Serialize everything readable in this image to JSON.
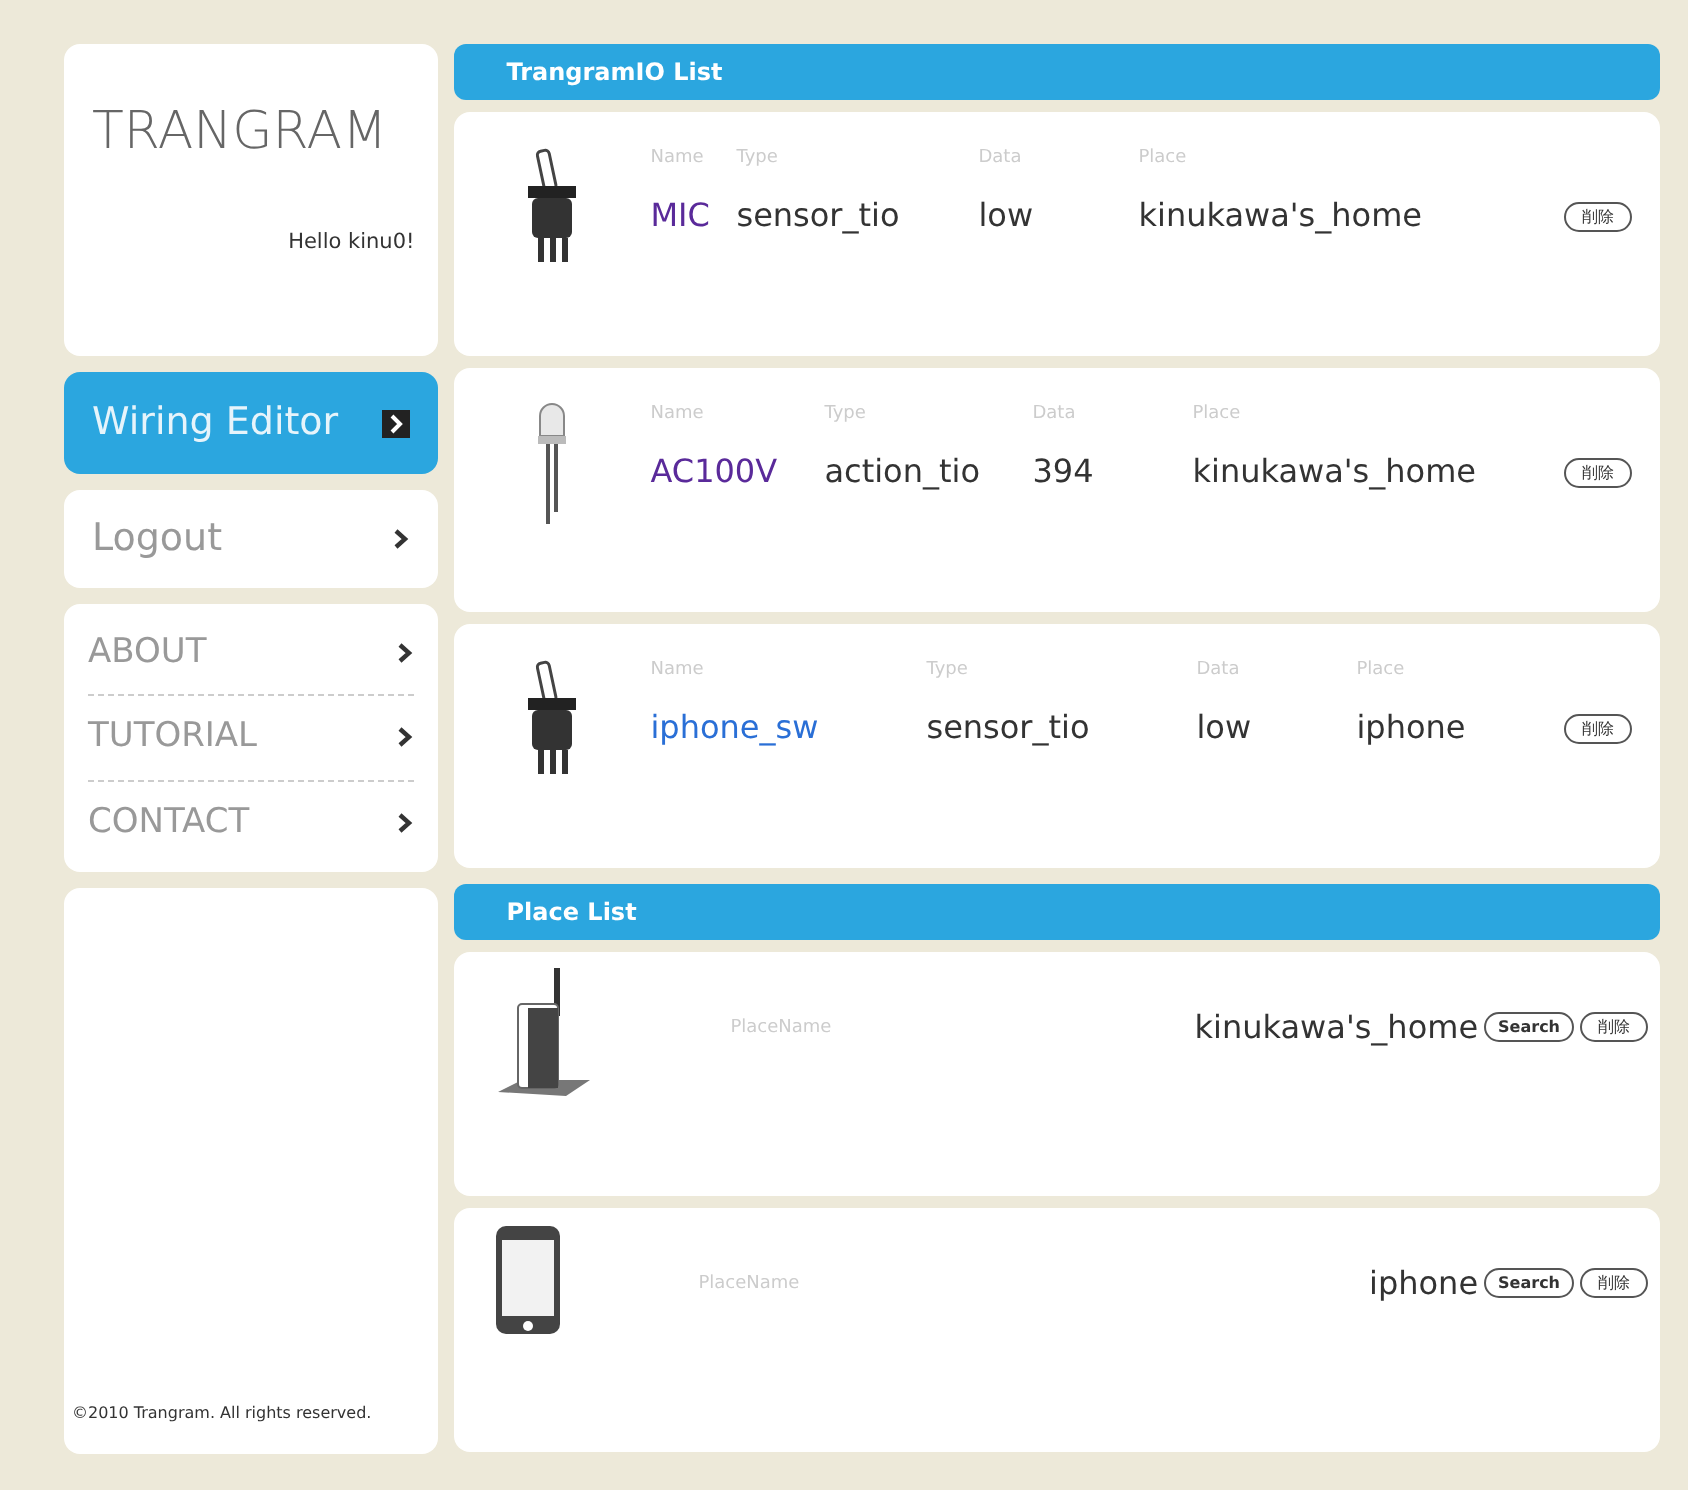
{
  "sidebar": {
    "logo": "TRANGRAM",
    "greeting": "Hello kinu0!",
    "nav_groups": [
      {
        "items": [
          {
            "label": "Wiring Editor",
            "selected": true
          }
        ]
      },
      {
        "items": [
          {
            "label": "Logout",
            "selected": false
          }
        ]
      },
      {
        "items": [
          {
            "label": "ABOUT",
            "selected": false
          },
          {
            "label": "TUTORIAL",
            "selected": false
          },
          {
            "label": "CONTACT",
            "selected": false
          }
        ]
      }
    ],
    "footer": "©2010 Trangram. All rights reserved."
  },
  "io_list": {
    "title": "TrangramIO List",
    "rows": [
      {
        "kind": "switch",
        "name_label": "Name",
        "type_label": "Type",
        "data_label": "Data",
        "place_label": "Place",
        "name": "MIC",
        "visited": true,
        "type": "sensor_tio",
        "data": "low",
        "place": "kinukawa's_home",
        "delete": "削除"
      },
      {
        "kind": "led",
        "name_label": "Name",
        "type_label": "Type",
        "data_label": "Data",
        "place_label": "Place",
        "name": "AC100V",
        "visited": true,
        "type": "action_tio",
        "data": "394",
        "place": "kinukawa's_home",
        "delete": "削除"
      },
      {
        "kind": "switch",
        "name_label": "Name",
        "type_label": "Type",
        "data_label": "Data",
        "place_label": "Place",
        "name": "iphone_sw",
        "visited": false,
        "type": "sensor_tio",
        "data": "low",
        "place": "iphone",
        "delete": "削除"
      }
    ]
  },
  "place_list": {
    "title": "Place List",
    "rows": [
      {
        "kind": "router",
        "label": "PlaceName",
        "name": "kinukawa's_home",
        "search": "Search",
        "delete": "削除"
      },
      {
        "kind": "phone",
        "label": "PlaceName",
        "name": "iphone",
        "search": "Search",
        "delete": "削除"
      }
    ]
  }
}
